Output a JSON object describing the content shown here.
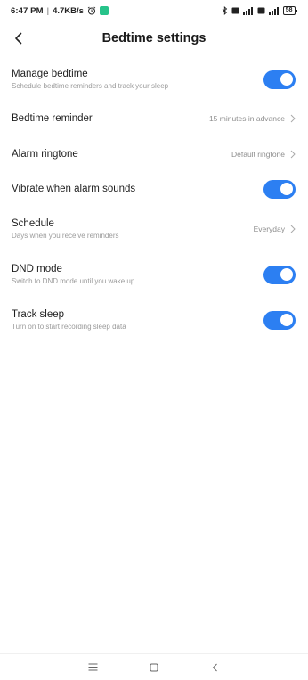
{
  "status_bar": {
    "time": "6:47 PM",
    "separator": "|",
    "speed": "4.7KB/s",
    "battery_level": "58",
    "icons": [
      "alarm-icon",
      "app-badge-icon",
      "bluetooth-icon",
      "volte-icon",
      "signal-icon",
      "volte-icon",
      "signal-icon",
      "battery-icon"
    ]
  },
  "header": {
    "title": "Bedtime settings",
    "back_icon": "back-arrow-icon"
  },
  "settings": {
    "manage_bedtime": {
      "title": "Manage bedtime",
      "subtitle": "Schedule bedtime reminders and track your sleep",
      "enabled": true
    },
    "bedtime_reminder": {
      "title": "Bedtime reminder",
      "value": "15 minutes in advance"
    },
    "alarm_ringtone": {
      "title": "Alarm ringtone",
      "value": "Default ringtone"
    },
    "vibrate": {
      "title": "Vibrate when alarm sounds",
      "enabled": true
    },
    "schedule": {
      "title": "Schedule",
      "subtitle": "Days when you receive reminders",
      "value": "Everyday"
    },
    "dnd_mode": {
      "title": "DND mode",
      "subtitle": "Switch to DND mode until you wake up",
      "enabled": true
    },
    "track_sleep": {
      "title": "Track sleep",
      "subtitle": "Turn on to start recording sleep data",
      "enabled": true
    }
  },
  "colors": {
    "accent": "#2c7ff2",
    "title_text": "#1f1f1f",
    "secondary_text": "#9a9a9a",
    "background": "#ffffff"
  },
  "nav_bar": {
    "icons": [
      "menu-icon",
      "home-icon",
      "back-icon"
    ]
  }
}
